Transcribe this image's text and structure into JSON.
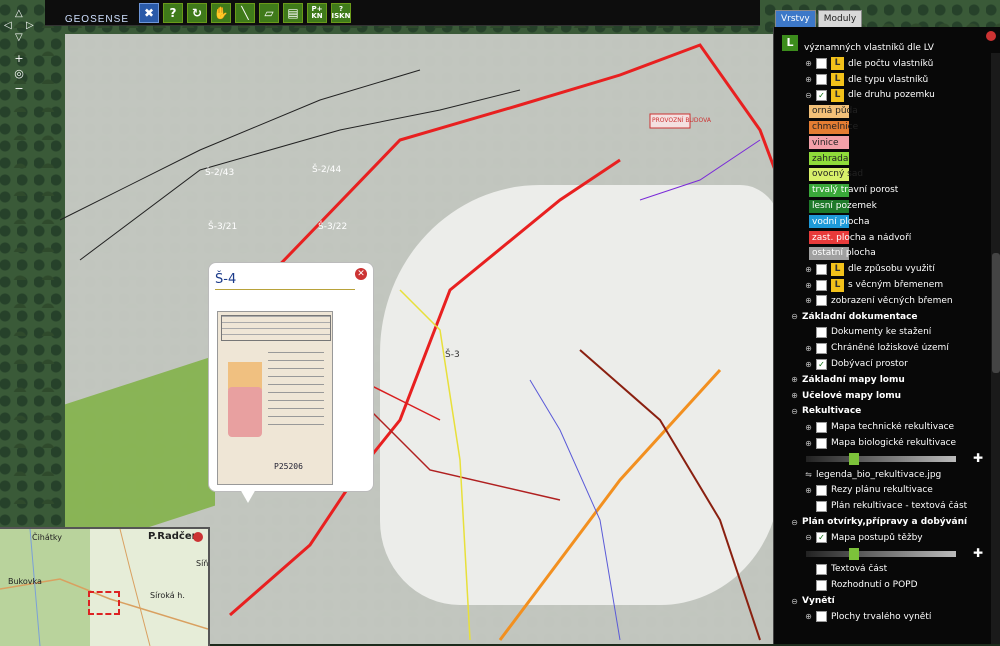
{
  "toolbar": {
    "logo_text": "GEOSENSE",
    "buttons": [
      {
        "icon": "tools-icon",
        "glyph": "✖"
      },
      {
        "icon": "help-icon",
        "glyph": "?"
      },
      {
        "icon": "refresh-icon",
        "glyph": "↻"
      },
      {
        "icon": "pan-hand-icon",
        "glyph": "✋"
      },
      {
        "icon": "measure-line-icon",
        "glyph": "╲"
      },
      {
        "icon": "measure-area-icon",
        "glyph": "▱"
      },
      {
        "icon": "print-icon",
        "glyph": "▤"
      },
      {
        "icon": "parcel-kn-icon",
        "glyph": "P+ KN"
      },
      {
        "icon": "iskn-icon",
        "glyph": "? ISKN"
      }
    ]
  },
  "map": {
    "labels": [
      "Š-2/43",
      "Š-2/44",
      "Š-3/21",
      "Š-3/22",
      "Š-3"
    ],
    "building_label": "PROVOZNÍ BUDOVA"
  },
  "popup": {
    "title": "Š-4",
    "doc_number": "P25206"
  },
  "overview": {
    "title": "P.Radčem",
    "labels": [
      "Čihátky",
      "Bukovka",
      "Síroká h.",
      "Síň"
    ]
  },
  "tabs": [
    "Vrstvy",
    "Moduly"
  ],
  "panel": {
    "logo_glyph": "L",
    "items": [
      {
        "type": "text",
        "label": "významných vlastníků dle LV",
        "indent": 30
      },
      {
        "type": "layer",
        "label": "dle počtu vlastníků",
        "indent": 22,
        "checked": false,
        "licon": true,
        "eye": true,
        "exp": "⊕"
      },
      {
        "type": "layer",
        "label": "dle typu vlastníků",
        "indent": 22,
        "checked": false,
        "licon": true,
        "eye": true,
        "exp": "⊕"
      },
      {
        "type": "layer",
        "label": "dle druhu pozemku",
        "indent": 22,
        "checked": true,
        "licon": true,
        "eye": true,
        "exp": "⊖"
      },
      {
        "type": "legend",
        "label": "orná půda",
        "color": "#f2c078"
      },
      {
        "type": "legend",
        "label": "chmelnice",
        "color": "#e57d32"
      },
      {
        "type": "legend",
        "label": "vinice",
        "color": "#f2a0a8"
      },
      {
        "type": "legend",
        "label": "zahrada",
        "color": "#8fdc3a"
      },
      {
        "type": "legend",
        "label": "ovocný sad",
        "color": "#d8f06a"
      },
      {
        "type": "legend",
        "label": "trvalý travní porost",
        "color": "#3aa83a"
      },
      {
        "type": "legend",
        "label": "lesní pozemek",
        "color": "#1e7a2a"
      },
      {
        "type": "legend",
        "label": "vodní plocha",
        "color": "#1e9ad8"
      },
      {
        "type": "legend",
        "label": "zast. plocha a nádvoří",
        "color": "#e83a3a"
      },
      {
        "type": "legend",
        "label": "ostatní plocha",
        "color": "#a0a0a0"
      },
      {
        "type": "layer",
        "label": "dle způsobu využití",
        "indent": 22,
        "checked": false,
        "licon": true,
        "eye": true,
        "exp": "⊕"
      },
      {
        "type": "layer",
        "label": "s věcným břemenem",
        "indent": 22,
        "checked": false,
        "licon": true,
        "eye": true,
        "exp": "⊕"
      },
      {
        "type": "layer",
        "label": "zobrazení věcných břemen",
        "indent": 22,
        "checked": false,
        "licon": false,
        "eye": false,
        "exp": "⊕"
      },
      {
        "type": "section",
        "label": "Základní dokumentace",
        "exp": "⊖"
      },
      {
        "type": "layer",
        "label": "Dokumenty ke stažení",
        "indent": 22,
        "checked": false,
        "folder": true,
        "exp": ""
      },
      {
        "type": "layer",
        "label": "Chráněné ložiskové území",
        "indent": 22,
        "checked": false,
        "folder": true,
        "exp": "⊕"
      },
      {
        "type": "layer",
        "label": "Dobývací prostor",
        "indent": 22,
        "checked": true,
        "folder": true,
        "exp": "⊕"
      },
      {
        "type": "section",
        "label": "Základní mapy lomu",
        "exp": "⊕"
      },
      {
        "type": "section",
        "label": "Účelové mapy lomu",
        "exp": "⊕"
      },
      {
        "type": "section",
        "label": "Rekultivace",
        "exp": "⊖"
      },
      {
        "type": "layer",
        "label": "Mapa technické rekultivace",
        "indent": 22,
        "checked": false,
        "folder": true,
        "exp": "⊕"
      },
      {
        "type": "layer",
        "label": "Mapa biologické rekultivace",
        "indent": 22,
        "checked": false,
        "folder": true,
        "exp": "⊕"
      },
      {
        "type": "slider",
        "value": 0.32
      },
      {
        "type": "file",
        "label": "legenda_bio_rekultivace.jpg"
      },
      {
        "type": "layer",
        "label": "Řezy plánu rekultivace",
        "indent": 22,
        "checked": false,
        "folder": true,
        "exp": "⊕"
      },
      {
        "type": "layer",
        "label": "Plán rekultivace - textová část",
        "indent": 22,
        "checked": false,
        "folder": true,
        "exp": ""
      },
      {
        "type": "section",
        "label": "Plán otvírky,přípravy a dobývání",
        "exp": "⊖"
      },
      {
        "type": "layer",
        "label": "Mapa postupů těžby",
        "indent": 22,
        "checked": true,
        "eye": true,
        "exp": "⊖"
      },
      {
        "type": "slider",
        "value": 0.32
      },
      {
        "type": "layer",
        "label": "Textová část",
        "indent": 22,
        "checked": false,
        "folder": true,
        "exp": ""
      },
      {
        "type": "layer",
        "label": "Rozhodnutí o POPD",
        "indent": 22,
        "checked": false,
        "folder": true,
        "exp": ""
      },
      {
        "type": "section",
        "label": "Vynětí",
        "exp": "⊖"
      },
      {
        "type": "layer",
        "label": "Plochy trvalého vynětí",
        "indent": 22,
        "checked": false,
        "folder": true,
        "exp": "⊕"
      }
    ]
  }
}
